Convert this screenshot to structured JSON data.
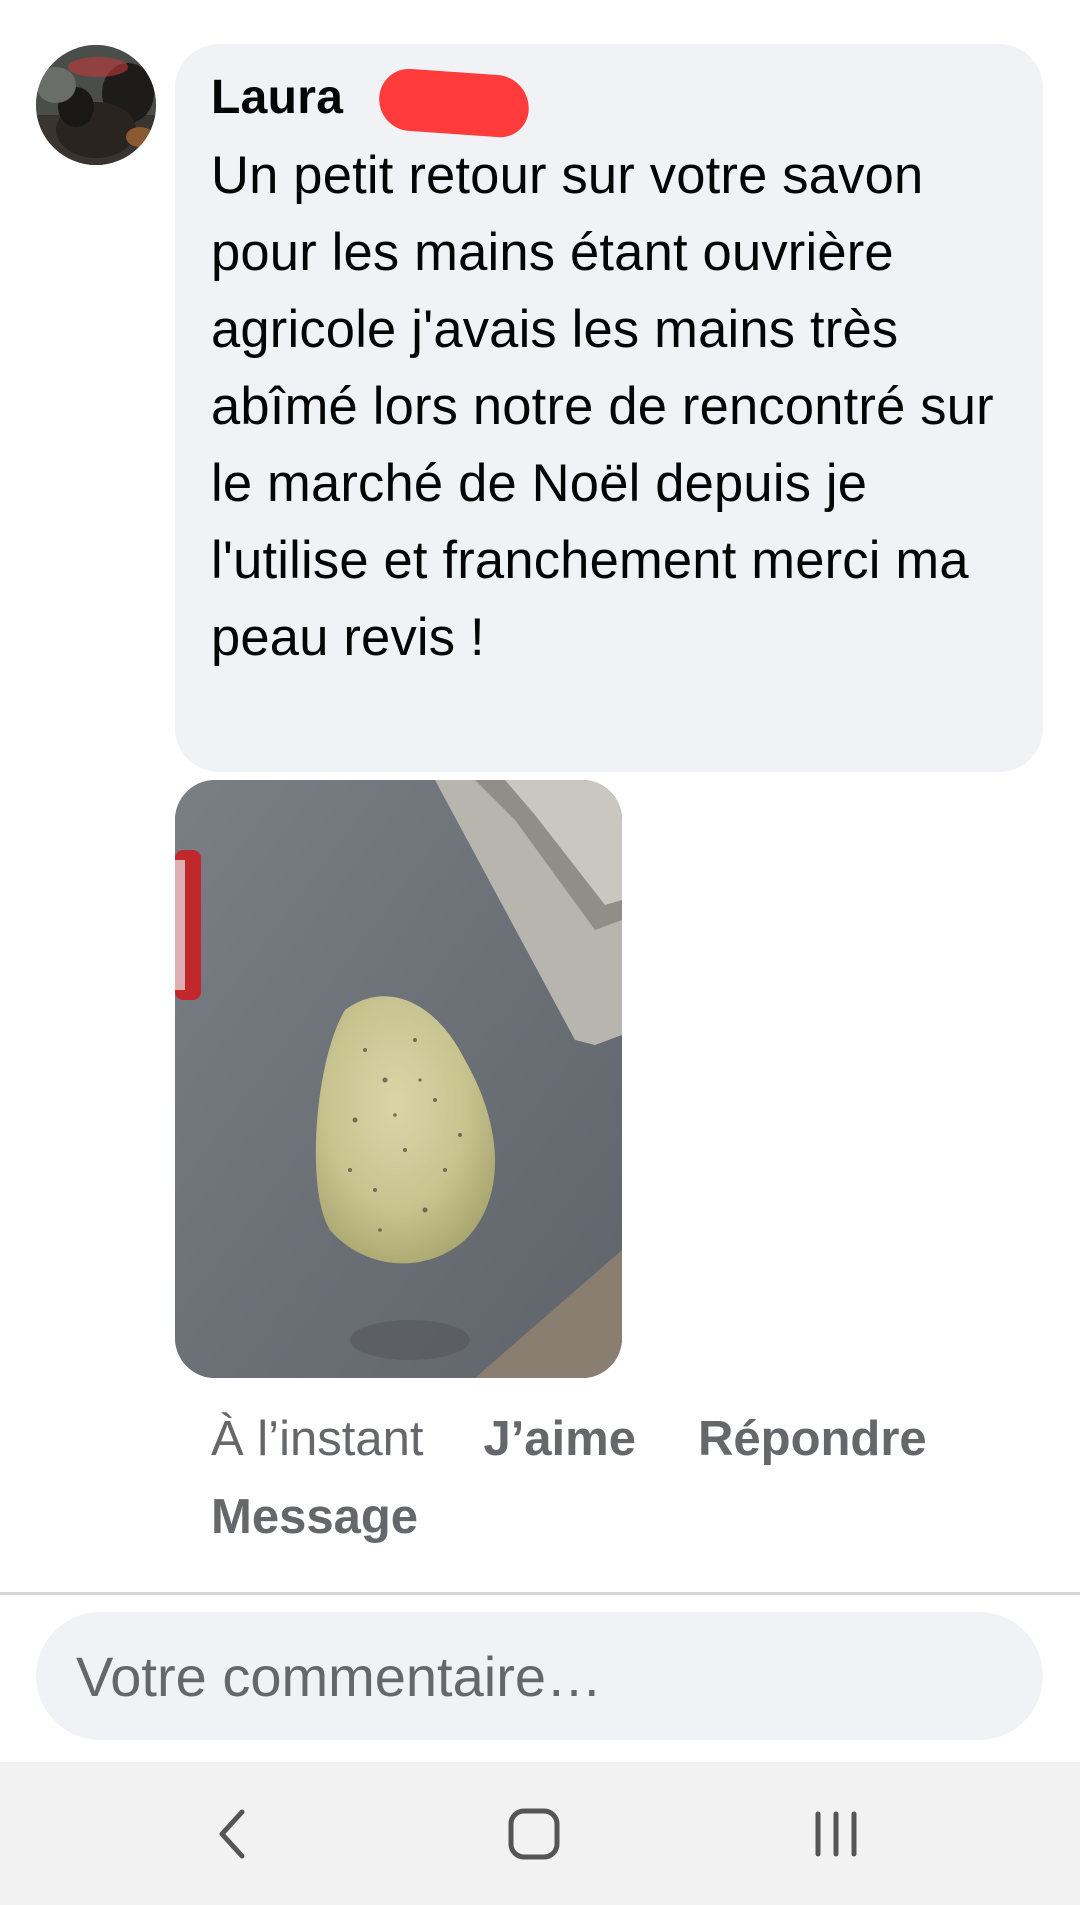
{
  "comment": {
    "author": "Laura",
    "text": "Un petit retour sur votre savon pour les mains étant ouvrière agricole j'avais les mains très abîmé lors notre de rencontré sur le marché de Noël depuis je l'utilise et franchement merci ma peau revis !"
  },
  "actions": {
    "timestamp": "À l’instant",
    "like_label": "J’aime",
    "reply_label": "Répondre",
    "message_label": "Message"
  },
  "composer": {
    "placeholder": "Votre commentaire…"
  },
  "navigation": {
    "back_icon": "chevron-left-icon",
    "home_icon": "home-square-icon",
    "recents_icon": "recent-apps-icon"
  },
  "colors": {
    "bubble": "#f0f2f5",
    "redaction": "#ff3b3b",
    "secondary_text": "#65676b",
    "navbar": "#f2f2f2"
  }
}
